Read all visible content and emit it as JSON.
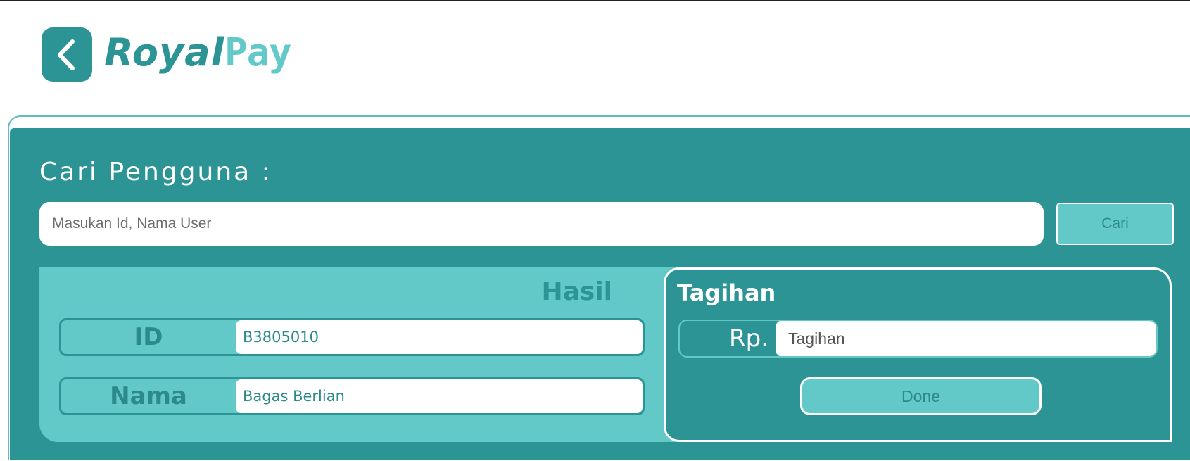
{
  "header": {
    "back_icon": "chevron-left-icon",
    "logo_royal": "Royal",
    "logo_pay": "Pay"
  },
  "search": {
    "title": "Cari Pengguna :",
    "placeholder": "Masukan Id, Nama User",
    "button_label": "Cari"
  },
  "result": {
    "title": "Hasil",
    "fields": [
      {
        "label": "ID",
        "value": "B3805010"
      },
      {
        "label": "Nama",
        "value": "Bagas Berlian"
      }
    ]
  },
  "tagihan": {
    "title": "Tagihan",
    "currency_label": "Rp.",
    "placeholder": "Tagihan",
    "done_label": "Done"
  },
  "colors": {
    "primary": "#2c9494",
    "accent": "#63c8c8",
    "white": "#ffffff"
  }
}
